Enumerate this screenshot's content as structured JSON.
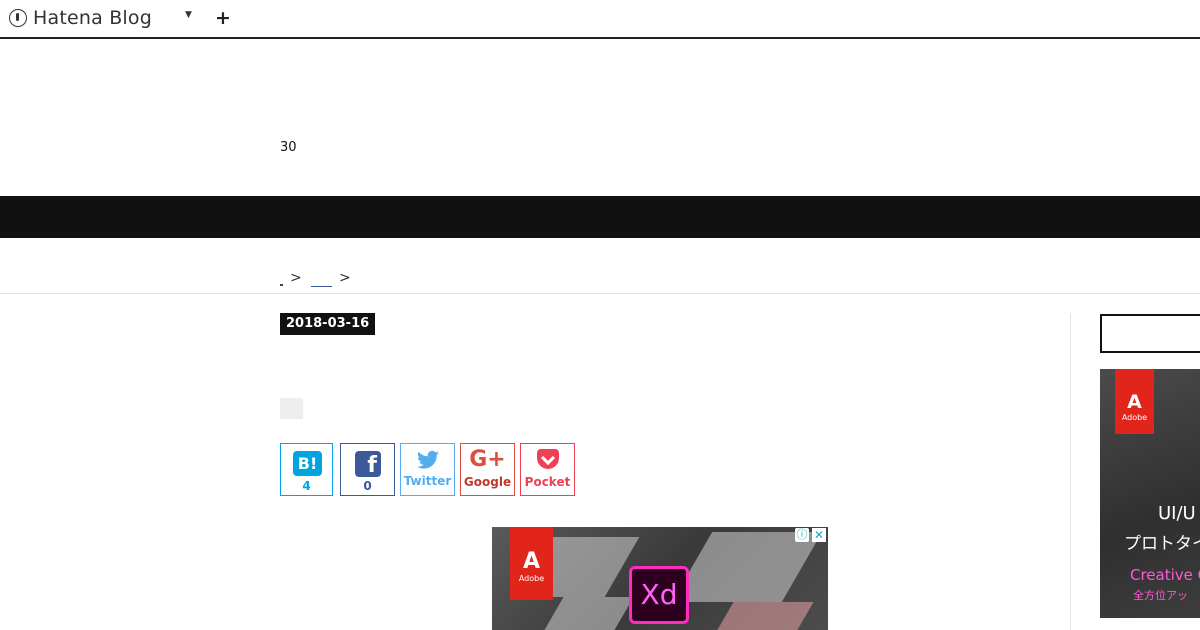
{
  "topbar": {
    "brand": "Hatena Blog",
    "dropdown_icon": "caret-down-icon",
    "add_icon": "plus-icon",
    "add_label": "+"
  },
  "header": {
    "number": "30"
  },
  "breadcrumb": {
    "sep1": ">",
    "sep2": ">"
  },
  "article": {
    "date": "2018-03-16"
  },
  "share": {
    "hatena": {
      "icon_text": "B!",
      "count": "4"
    },
    "facebook": {
      "icon_text": "f",
      "count": "0"
    },
    "twitter": {
      "label": "Twitter"
    },
    "google": {
      "icon_text": "G+",
      "label": "Google"
    },
    "pocket": {
      "label": "Pocket"
    }
  },
  "ads": {
    "main": {
      "logo_letter": "A",
      "logo_text": "Adobe",
      "product": "Xd",
      "info": "ⓘ",
      "close": "✕"
    },
    "side": {
      "logo_letter": "A",
      "logo_text": "Adobe",
      "line1": "UI/U",
      "line2": "プロトタイ",
      "line3": "Creative C",
      "line4": "全方位アッ"
    }
  },
  "colors": {
    "navbar": "#111111",
    "hatena": "#00a4de",
    "facebook": "#3b5998",
    "twitter": "#55acee",
    "google": "#dc4e41",
    "pocket": "#ef4056",
    "adobe": "#e1251b"
  }
}
